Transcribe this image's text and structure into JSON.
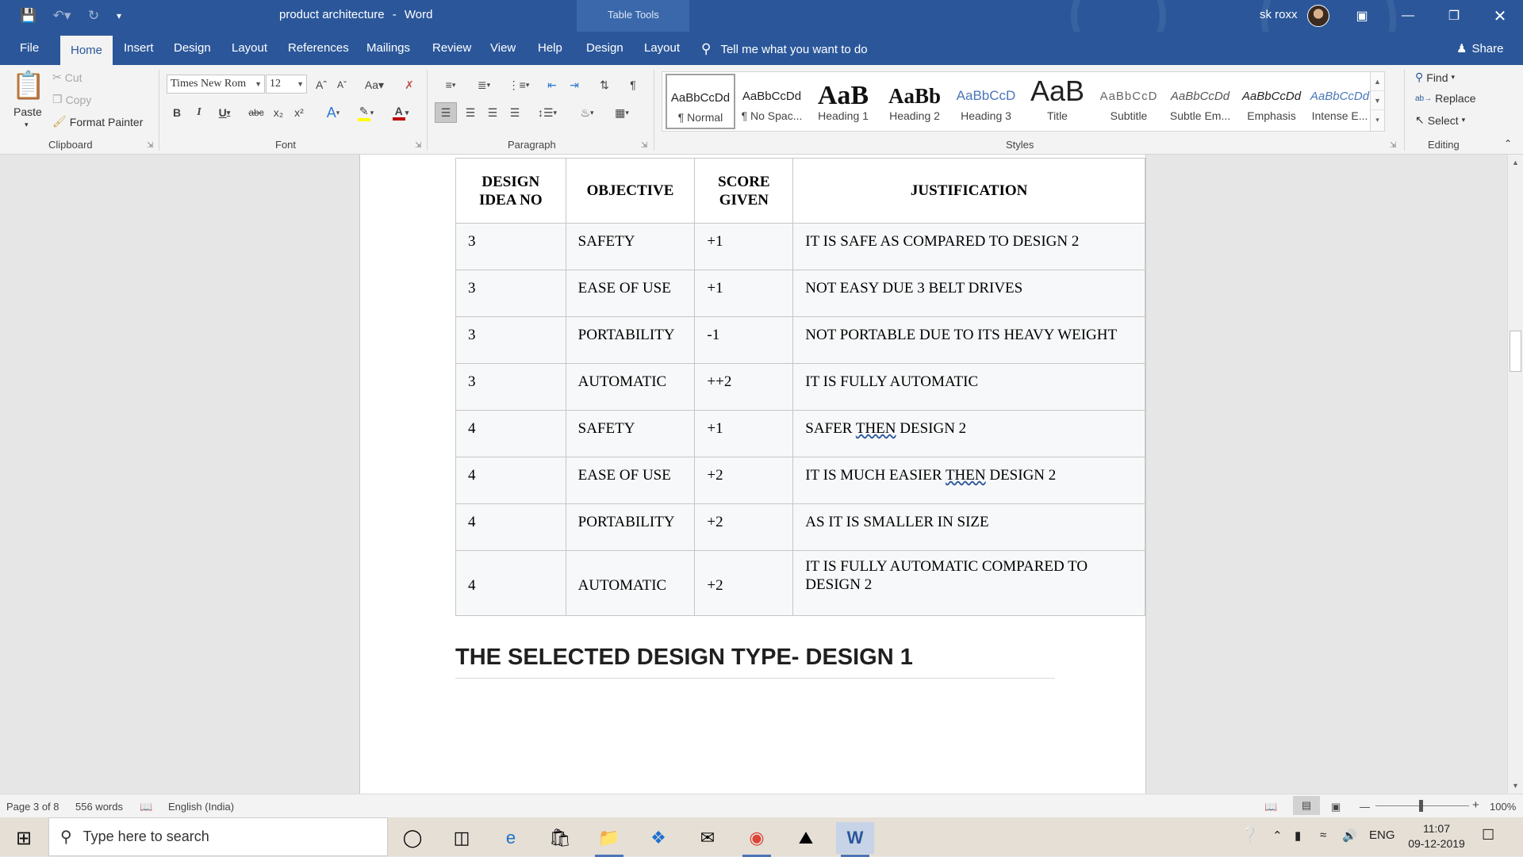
{
  "window": {
    "document_name": "product architecture",
    "app_name": "Word",
    "title_separator": "-",
    "contextual_tab_group": "Table Tools",
    "user_name": "sk roxx"
  },
  "menu_tabs": [
    "File",
    "Home",
    "Insert",
    "Design",
    "Layout",
    "References",
    "Mailings",
    "Review",
    "View",
    "Help",
    "Design",
    "Layout"
  ],
  "tell_me": "Tell me what you want to do",
  "share": "Share",
  "ribbon": {
    "clipboard": {
      "paste": "Paste",
      "cut": "Cut",
      "copy": "Copy",
      "format_painter": "Format Painter",
      "label": "Clipboard"
    },
    "font": {
      "name": "Times New Rom",
      "size": "12",
      "case": "Aa",
      "label": "Font"
    },
    "paragraph": {
      "label": "Paragraph"
    },
    "styles": {
      "label": "Styles",
      "items": [
        {
          "sample": "AaBbCcDd",
          "name": "¶ Normal"
        },
        {
          "sample": "AaBbCcDd",
          "name": "¶ No Spac..."
        },
        {
          "sample": "AaB",
          "name": "Heading 1"
        },
        {
          "sample": "AaBb",
          "name": "Heading 2"
        },
        {
          "sample": "AaBbCcD",
          "name": "Heading 3"
        },
        {
          "sample": "AaB",
          "name": "Title"
        },
        {
          "sample": "AaBbCcD",
          "name": "Subtitle"
        },
        {
          "sample": "AaBbCcDd",
          "name": "Subtle Em..."
        },
        {
          "sample": "AaBbCcDd",
          "name": "Emphasis"
        },
        {
          "sample": "AaBbCcDd",
          "name": "Intense E..."
        }
      ]
    },
    "editing": {
      "find": "Find",
      "replace": "Replace",
      "select": "Select",
      "label": "Editing"
    }
  },
  "document": {
    "table": {
      "headers": [
        "DESIGN IDEA NO",
        "OBJECTIVE",
        "SCORE GIVEN",
        "JUSTIFICATION"
      ],
      "rows": [
        [
          "3",
          "SAFETY",
          "+1",
          "IT IS SAFE AS COMPARED TO DESIGN 2"
        ],
        [
          "3",
          "EASE OF USE",
          "+1",
          "NOT EASY DUE 3 BELT DRIVES"
        ],
        [
          "3",
          "PORTABILITY",
          "-1",
          "NOT PORTABLE DUE TO ITS HEAVY WEIGHT"
        ],
        [
          "3",
          "AUTOMATIC",
          "++2",
          "IT IS FULLY AUTOMATIC"
        ],
        [
          "4",
          "SAFETY",
          "+1",
          "SAFER THEN DESIGN 2"
        ],
        [
          "4",
          "EASE OF USE",
          "+2",
          "IT IS MUCH EASIER THEN DESIGN 2"
        ],
        [
          "4",
          "PORTABILITY",
          "+2",
          "AS IT IS SMALLER IN SIZE"
        ],
        [
          "4",
          "AUTOMATIC",
          "+2",
          "IT IS FULLY AUTOMATIC COMPARED TO DESIGN 2"
        ]
      ]
    },
    "heading": "THE SELECTED DESIGN TYPE- DESIGN 1"
  },
  "status": {
    "page": "Page 3 of 8",
    "words": "556 words",
    "language": "English (India)",
    "zoom": "100%"
  },
  "taskbar": {
    "search_placeholder": "Type here to search",
    "language": "ENG",
    "time": "11:07",
    "date": "09-12-2019"
  },
  "colors": {
    "accent": "#2b579a",
    "ribbon_bg": "#f3f3f3",
    "page_bg": "#ffffff",
    "font_color_bar": "#c00000",
    "highlight_bar": "#ffff00"
  }
}
